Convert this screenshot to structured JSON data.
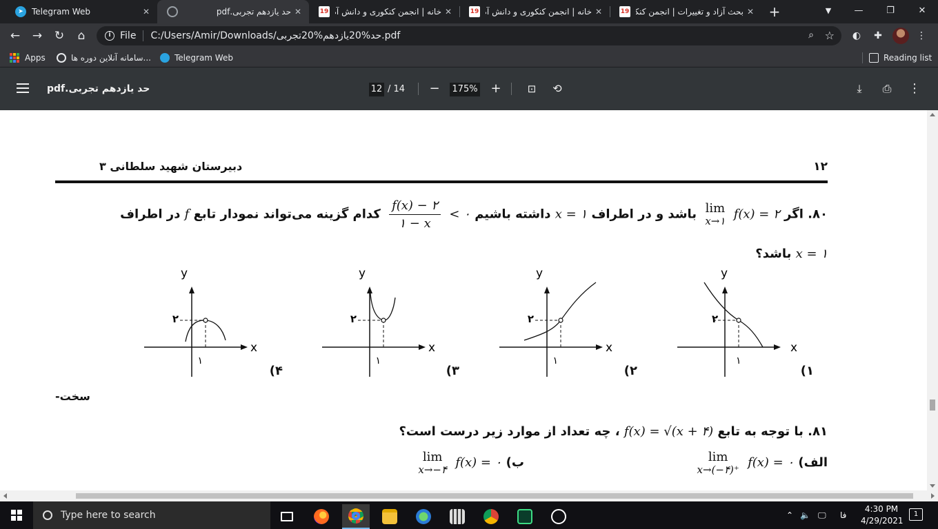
{
  "tabs": [
    {
      "title": "Telegram Web",
      "icon": "telegram-icon",
      "active": false
    },
    {
      "title": "حد یازدهم تجربی.pdf",
      "icon": "globe-icon",
      "active": true
    },
    {
      "title": "خانه | انجمن کنکوری و دانش آم",
      "icon": "site-19-icon",
      "active": false
    },
    {
      "title": "خانه | انجمن کنکوری و دانش آم",
      "icon": "site-19-icon",
      "active": false
    },
    {
      "title": "بحث آزاد و تغییرات | انجمن کنکو",
      "icon": "site-19-icon",
      "active": false
    }
  ],
  "omnibox": {
    "scheme_label": "File",
    "url": "C:/Users/Amir/Downloads/حد%20یازدهم%20تجربی.pdf"
  },
  "bookmarks": {
    "apps": "Apps",
    "items": [
      "سامانه آنلاین دوره ها...",
      "Telegram Web"
    ],
    "reading_list": "Reading list"
  },
  "pdf": {
    "title": "حد یازدهم تجربی.pdf",
    "current_page": "12",
    "total_pages": "/ 14",
    "zoom": "175%"
  },
  "page": {
    "header_page_number": "۱۲",
    "header_school": "دبیرستان شهید سلطانی ۳",
    "q80": {
      "number": "۸۰.",
      "text_a": "اگر",
      "text_b": "باشد و در اطراف",
      "text_c": "داشته باشیم",
      "text_d": "کدام گزینه می‌تواند نمودار تابع",
      "text_e": "در اطراف",
      "line2": "باشد؟",
      "fraction_num": "f(x) − ۲",
      "fraction_den": "۱ − x",
      "lim_sub": "x→۱",
      "lim_word": "lim",
      "fx_eq": "f(x) = ۲",
      "x_eq_1": "x = ۱",
      "lt_zero": "< ۰",
      "f_letter": "f"
    },
    "graphs": [
      {
        "option": "۱)",
        "y_label": "y",
        "x_label": "x",
        "y_tick": "۲",
        "x_tick": "۱"
      },
      {
        "option": "۲)",
        "y_label": "y",
        "x_label": "x",
        "y_tick": "۲",
        "x_tick": "۱"
      },
      {
        "option": "۳)",
        "y_label": "y",
        "x_label": "x",
        "y_tick": "۲",
        "x_tick": "۱"
      },
      {
        "option": "۴)",
        "y_label": "y",
        "x_label": "x",
        "y_tick": "۲",
        "x_tick": "۱"
      }
    ],
    "difficulty": "-سخت",
    "q81": {
      "number": "۸۱.",
      "text_a": "با توجه به تابع",
      "func": "f(x) = √(x + ۴)",
      "text_b": "، چه تعداد از موارد زیر درست است؟",
      "part_a_label": "الف)",
      "part_a_expr": "f(x) = ۰",
      "part_a_sub": "x→(−۴)⁺",
      "part_b_label": "ب)",
      "part_b_expr": "f(x) = ۰",
      "part_b_sub": "x→−۴",
      "lim_word": "lim"
    }
  },
  "taskbar": {
    "search_placeholder": "Type here to search",
    "lang": "فا",
    "time": "4:30 PM",
    "date": "4/29/2021",
    "notifications": "1"
  }
}
